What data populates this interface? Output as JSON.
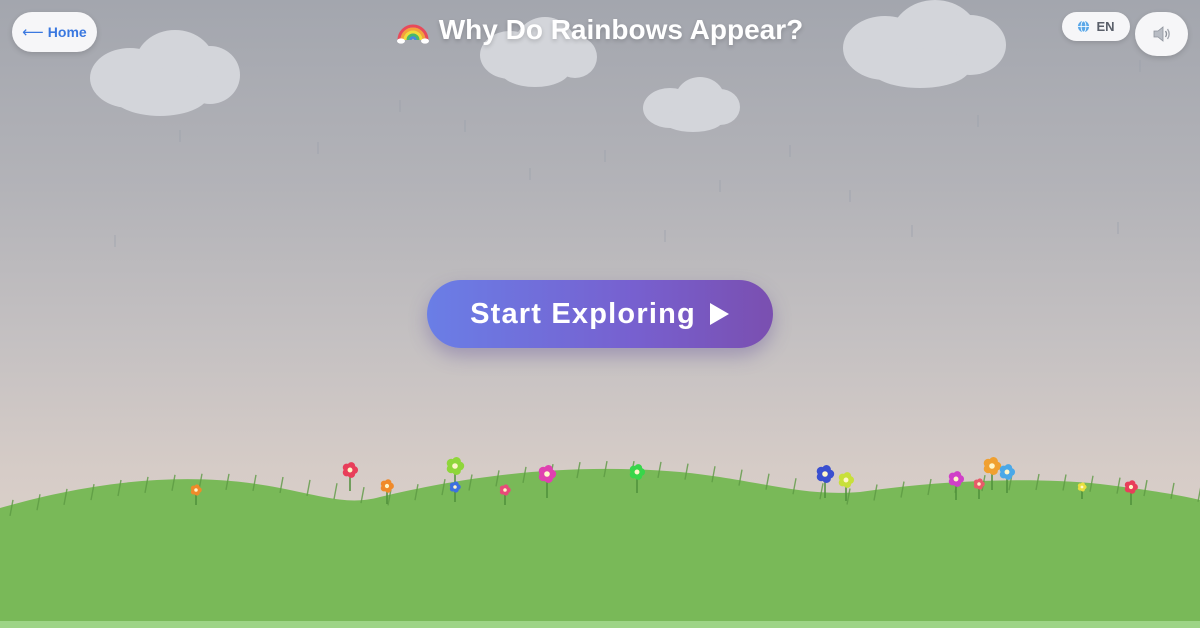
{
  "header": {
    "home_label": "Home",
    "home_icon": "left-arrow-icon",
    "title": "Why Do Rainbows Appear?",
    "title_icon": "rainbow-icon",
    "language_label": "EN",
    "language_icon": "globe-icon",
    "sound_icon": "speaker-icon"
  },
  "main": {
    "start_label": "Start Exploring",
    "start_icon": "play-icon"
  },
  "colors": {
    "accent_blue": "#3a78e0",
    "button_gradient_start": "#6a7ee6",
    "button_gradient_end": "#7a4fb0",
    "grass": "#79b958",
    "sky_top": "#a3a6ae",
    "sky_bottom": "#e2d6cf",
    "cloud": "#d3d5da"
  },
  "flower_colors": [
    "#e83e5a",
    "#f08a2a",
    "#8fd63a",
    "#3d6fe0",
    "#e040b0",
    "#e84a7a",
    "#38d64a",
    "#3a4fd0",
    "#c8e03a",
    "#d040c8",
    "#e85a6a",
    "#f0a030",
    "#4aa8e8",
    "#e8e040"
  ]
}
